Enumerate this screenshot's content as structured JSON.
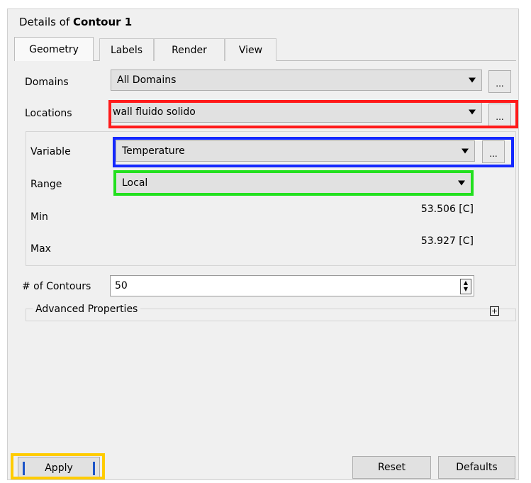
{
  "panel": {
    "title_prefix": "Details of ",
    "title_object": "Contour 1"
  },
  "tabs": [
    {
      "label": "Geometry",
      "active": true
    },
    {
      "label": "Labels",
      "active": false
    },
    {
      "label": "Render",
      "active": false
    },
    {
      "label": "View",
      "active": false
    }
  ],
  "domains": {
    "label": "Domains",
    "value": "All Domains"
  },
  "locations": {
    "label": "Locations",
    "value": "wall fluido solido"
  },
  "variable": {
    "label": "Variable",
    "value": "Temperature"
  },
  "range": {
    "label": "Range",
    "value": "Local"
  },
  "min": {
    "label": "Min",
    "value": "53.506 [C]"
  },
  "max": {
    "label": "Max",
    "value": "53.927 [C]"
  },
  "contours": {
    "label": "# of Contours",
    "value": "50"
  },
  "advanced": {
    "label": "Advanced Properties",
    "icon": "plus-box-icon"
  },
  "browse_label": "...",
  "buttons": {
    "apply": "Apply",
    "reset": "Reset",
    "defaults": "Defaults"
  },
  "highlight_colors": {
    "red": "#ff1a1a",
    "blue": "#1428ff",
    "green": "#22e01e",
    "yellow": "#ffcc00"
  }
}
